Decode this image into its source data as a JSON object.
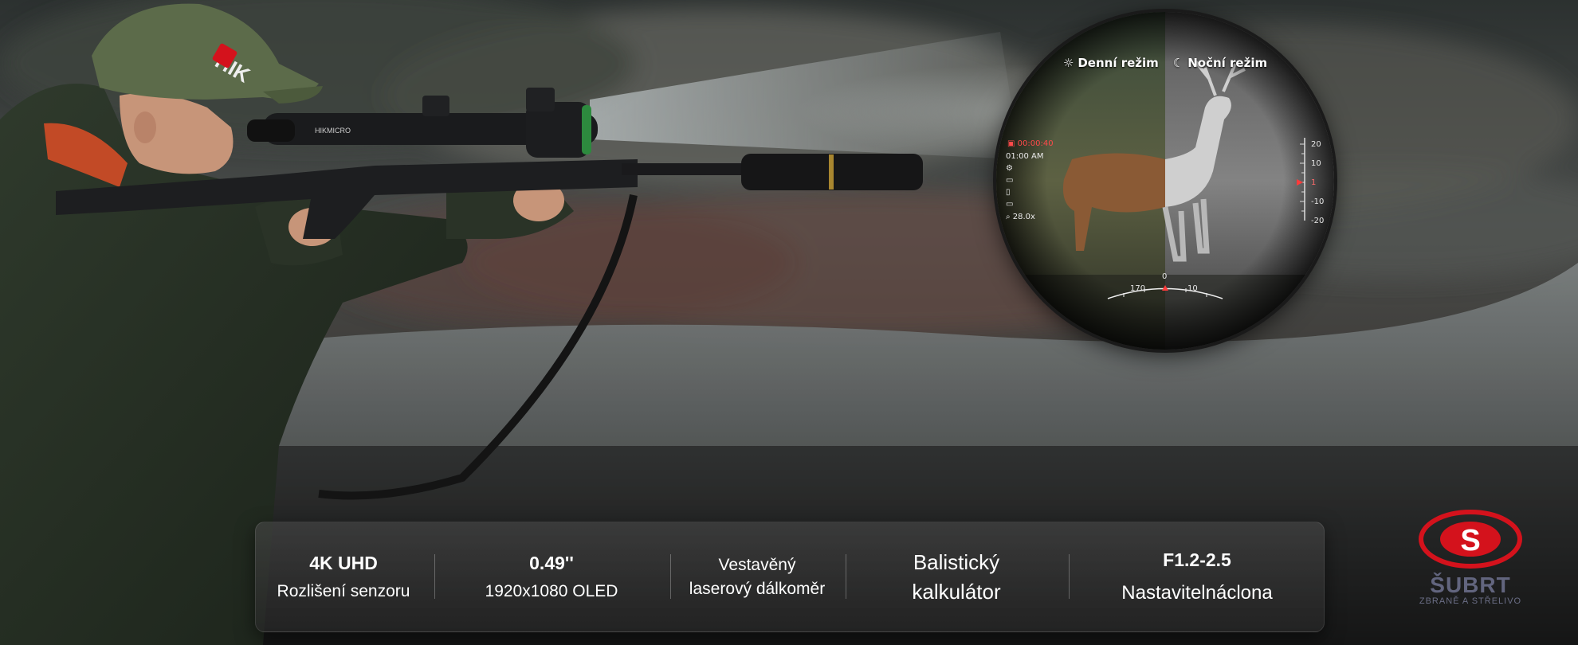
{
  "scope": {
    "day_mode": "Denní režim",
    "night_mode": "Noční režim",
    "rec_time": "00:00:40",
    "clock": "01:00 AM",
    "zoom": "28.0x",
    "vertical_scale": [
      "20",
      "10",
      "1",
      "-10",
      "-20"
    ],
    "bottom_scale": [
      "170",
      "0",
      "10"
    ]
  },
  "rifle_brand": "HIKMICRO",
  "cap_brand": "HIK",
  "specs": [
    {
      "line1": "4K UHD",
      "line2": "Rozlišení senzoru"
    },
    {
      "line1": "0.49''",
      "line2": "1920x1080 OLED"
    },
    {
      "line1": "Vestavěný",
      "line2": "laserový dálkoměr"
    },
    {
      "line1": "Balistický",
      "line2": "kalkulátor"
    },
    {
      "line1": "F1.2-2.5",
      "line2": "Nastavitelnáclona"
    }
  ],
  "logo": {
    "letter": "S",
    "word": "ŠUBRT",
    "tagline": "ZBRANĚ A STŘELIVO",
    "color": "#d4121c"
  }
}
